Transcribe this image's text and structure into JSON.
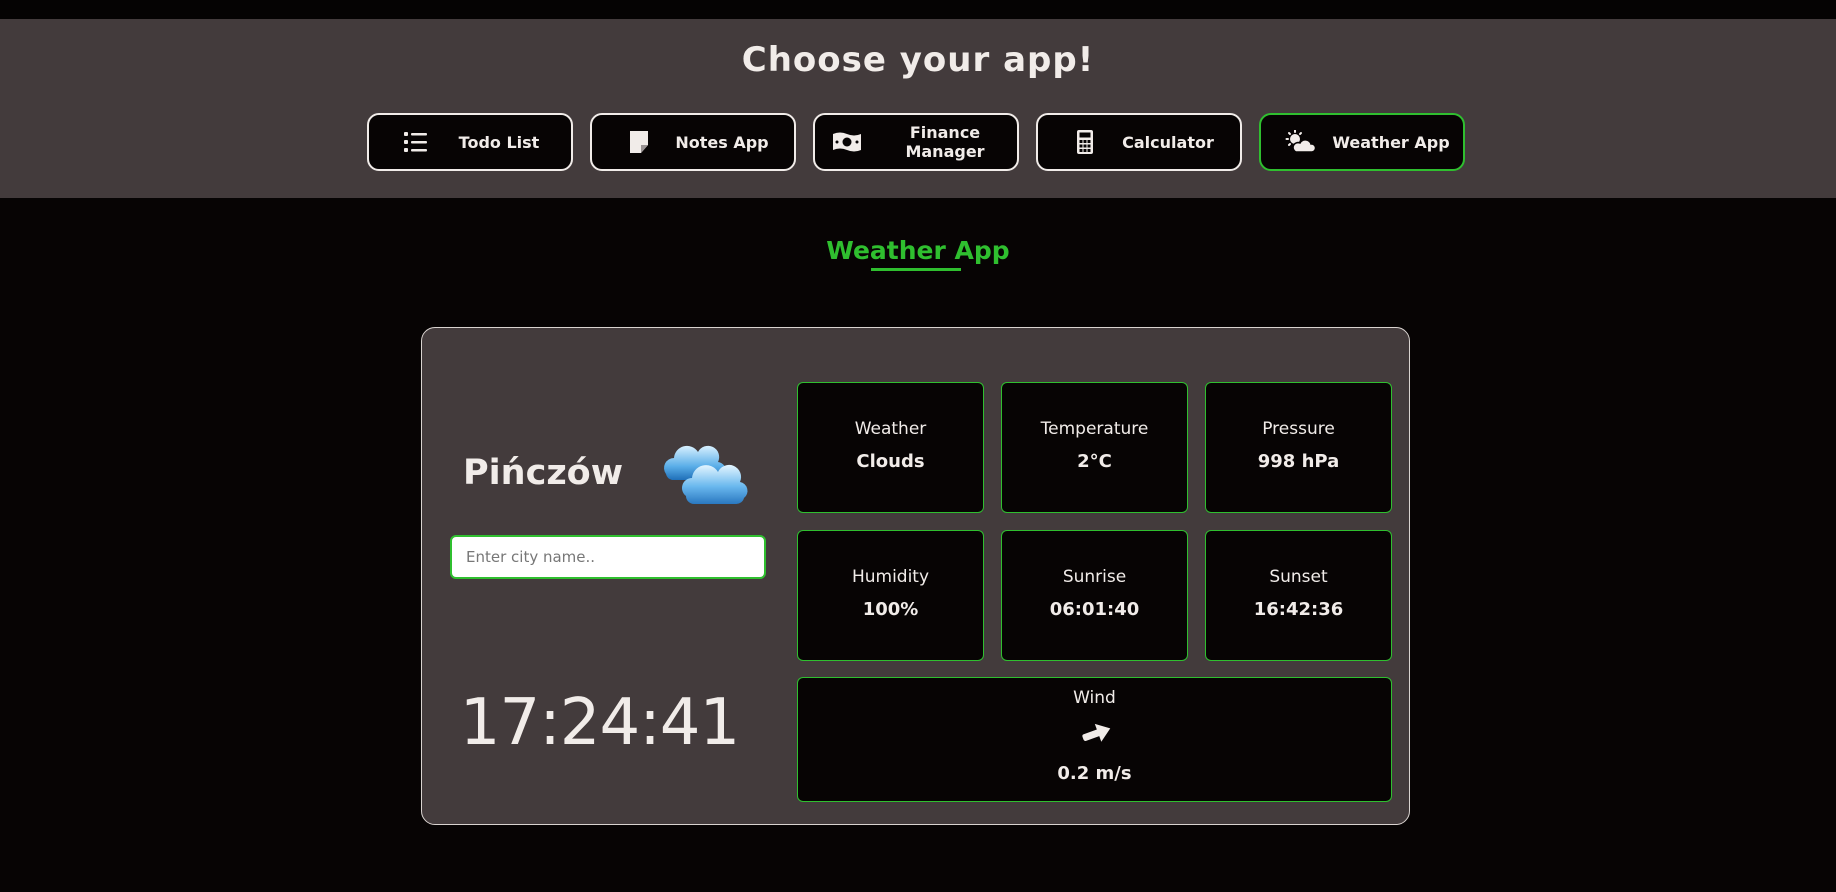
{
  "header": {
    "title": "Choose your app!"
  },
  "nav": [
    {
      "label": "Todo List",
      "icon": "list-icon"
    },
    {
      "label": "Notes App",
      "icon": "sticky-note-icon"
    },
    {
      "label": "Finance Manager",
      "icon": "money-bill-icon"
    },
    {
      "label": "Calculator",
      "icon": "calculator-icon"
    },
    {
      "label": "Weather App",
      "icon": "cloud-sun-icon",
      "active": true
    }
  ],
  "section": {
    "title": "Weather App"
  },
  "weather": {
    "city": "Pińczów",
    "condition_icon": "cloud-icon",
    "search": {
      "placeholder": "Enter city name..",
      "value": ""
    },
    "clock": "17:24:41",
    "tiles": [
      {
        "label": "Weather",
        "value": "Clouds"
      },
      {
        "label": "Temperature",
        "value": "2°C"
      },
      {
        "label": "Pressure",
        "value": "998 hPa"
      },
      {
        "label": "Humidity",
        "value": "100%"
      },
      {
        "label": "Sunrise",
        "value": "06:01:40"
      },
      {
        "label": "Sunset",
        "value": "16:42:36"
      }
    ],
    "wind": {
      "label": "Wind",
      "value": "0.2 m/s",
      "icon": "wind-direction-arrow-icon"
    }
  },
  "colors": {
    "accent": "#2fbf2f",
    "header_bg": "#433b3c",
    "page_bg": "#070404",
    "text": "#f1ece9"
  }
}
